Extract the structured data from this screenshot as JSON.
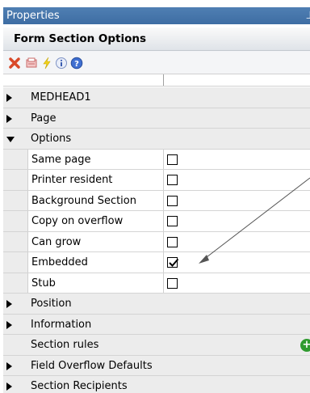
{
  "window": {
    "title": "Properties",
    "pin_glyph": "⊥"
  },
  "section": {
    "title": "Form Section Options"
  },
  "toolbar": {
    "icons": [
      "delete-icon",
      "print-preview-icon",
      "lightning-icon",
      "info-icon",
      "help-icon"
    ]
  },
  "rows": {
    "medhead": "MEDHEAD1",
    "page": "Page",
    "options": "Options",
    "same_page": {
      "label": "Same page",
      "checked": false
    },
    "printer_resident": {
      "label": "Printer resident",
      "checked": false
    },
    "background_section": {
      "label": "Background Section",
      "checked": false
    },
    "copy_on_overflow": {
      "label": "Copy on overflow",
      "checked": false
    },
    "can_grow": {
      "label": "Can grow",
      "checked": false
    },
    "embedded": {
      "label": "Embedded",
      "checked": true
    },
    "stub": {
      "label": "Stub",
      "checked": false
    },
    "position": "Position",
    "information": "Information",
    "section_rules": "Section rules",
    "field_overflow": "Field Overflow Defaults",
    "section_recipients": "Section Recipients"
  },
  "colors": {
    "title_bar": "#4f7fb3",
    "add_button": "#2e9a2e",
    "category_bg": "#ececec"
  }
}
